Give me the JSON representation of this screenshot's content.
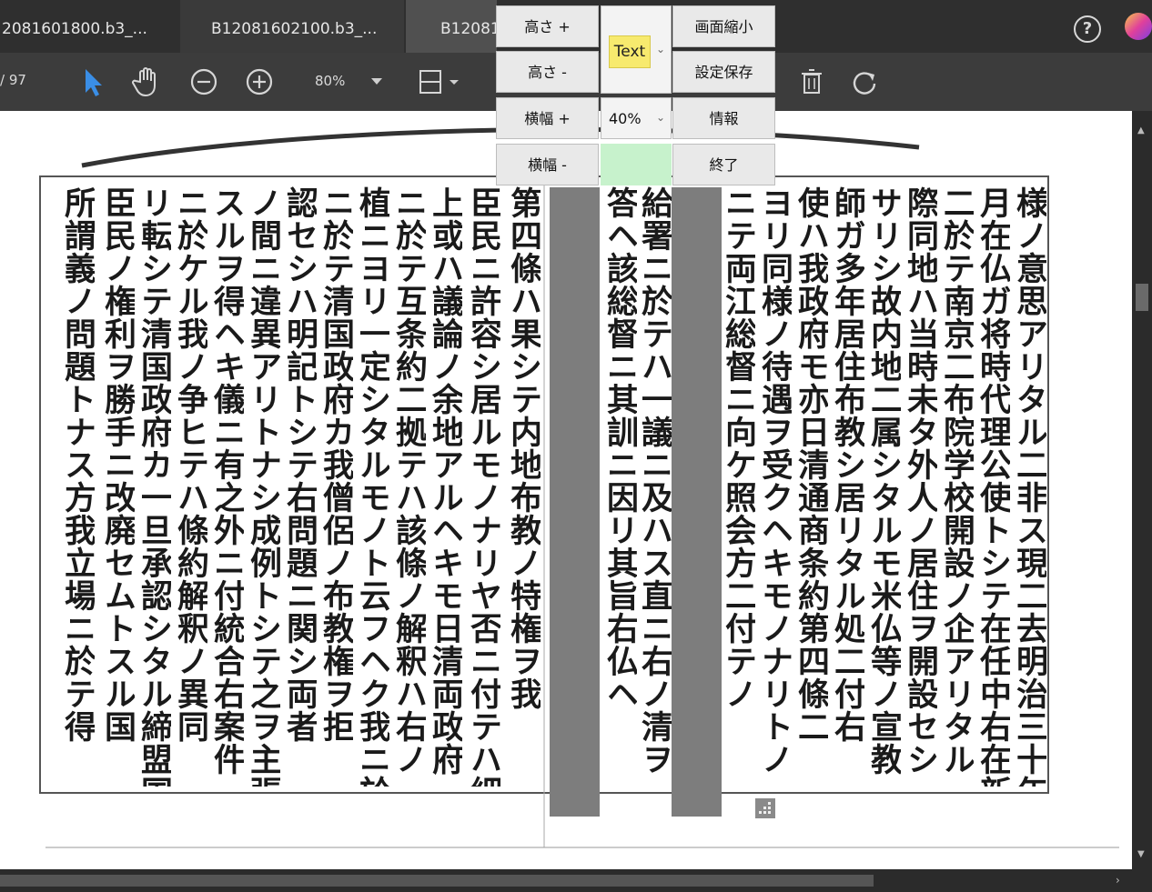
{
  "tabs": [
    {
      "label": "2081601800.b3_..."
    },
    {
      "label": "B12081602100.b3_..."
    },
    {
      "label": "B12081"
    }
  ],
  "toolbar": {
    "page_count": "/ 97",
    "zoom": "80%"
  },
  "panel": {
    "height_plus": "高さ +",
    "height_minus": "高さ -",
    "width_plus": "横幅 +",
    "width_minus": "横幅 -",
    "type_select": "Text",
    "percent_select": "40%",
    "shrink_screen": "画面縮小",
    "save_settings": "設定保存",
    "info": "情報",
    "exit": "終了"
  },
  "document": {
    "columns": [
      "様ノ意思アリタル二非ス現二去明治三十年十",
      "月在仏ガ将時代理公使トシテ在任中右在新ち",
      "二於テ南京二布院学校開設ノ企アリタル",
      "際同地ハ当時未タ外人ノ居住ヲ開設セシ",
      "サリシ故内地二属シタルモ米仏等ノ宣教",
      "師ガ多年居住布教シ居リタル処二付右",
      "使ハ我政府モ亦日清通商条約第四條二",
      "ヨリ同様ノ待遇ヲ受クヘキモノナリトノ",
      "ニテ両江総督ニ向ケ照会方二付テノ",
      "給署ニ於テハ一議ニ及ハス直ニ右ノ清ヲ",
      "答ヘ該総督ニ其訓ニ因リ其旨右仏ヘ",
      "第四條ハ果シテ内地布教ノ特権ヲ我",
      "臣民ニ許容シ居ルモノナリヤ否ニ付テハ細",
      "上或ハ議論ノ余地アルヘキモ日清両政府",
      "ニ於テ互条約二拠テハ該條ノ解釈ハ右ノ",
      "植ニヨリ一定シタルモノト云フヘク我ニ於テハ之",
      "ニ於テ清国政府カ我僧侶ノ布教権ヲ拒",
      "認セシハ明記トシテ右問題ニ関シ両者",
      "ノ間ニ違異アリトナシ成例トシテ之ヲ主張",
      "スルヲ得ヘキ儀ニ有之外ニ付統合右案件",
      "ニ於ケル我ノ争ヒテハ條約解釈ノ異同",
      "リ転シテ清国政府カ一旦承認シタル締盟国",
      "臣民ノ権利ヲ勝手ニ改廃セムトスル国",
      "所謂義ノ問題トナス方我立場ニ於テ得"
    ]
  }
}
